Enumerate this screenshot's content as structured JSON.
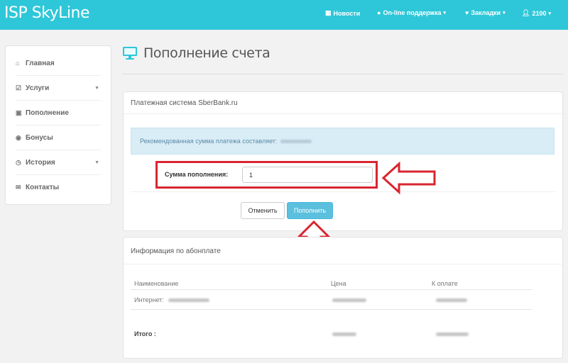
{
  "app": {
    "brand": "ISP SkyLine"
  },
  "topnav": {
    "items": [
      {
        "icon": "calendar-icon",
        "label": "Новости"
      },
      {
        "icon": "chat-icon",
        "label": "On-line поддержка"
      },
      {
        "icon": "heart-icon",
        "label": "Закладки"
      },
      {
        "icon": "user-icon",
        "label": "2100"
      }
    ]
  },
  "sidebar": {
    "items": [
      {
        "icon": "home-icon",
        "label": "Главная"
      },
      {
        "icon": "checkbox-icon",
        "label": "Услуги"
      },
      {
        "icon": "money-icon",
        "label": "Пополнение"
      },
      {
        "icon": "gift-icon",
        "label": "Бонусы"
      },
      {
        "icon": "clock-icon",
        "label": "История"
      },
      {
        "icon": "envelope-icon",
        "label": "Контакты"
      }
    ]
  },
  "page": {
    "title": "Пополнение счета"
  },
  "payment": {
    "header": "Платежная система SberBank.ru",
    "recommended_text": "Рекомендованная сумма платежа составляет:",
    "amount_label": "Сумма пополнения:",
    "amount_value": "1",
    "cancel_label": "Отменить",
    "submit_label": "Пополнить"
  },
  "fee_info": {
    "header": "Информация по абонплате",
    "columns": [
      "Наименование",
      "Цена",
      "К оплате"
    ],
    "row_label": "Интернет:",
    "total_label": "Итого :"
  },
  "colors": {
    "topbar": "#2ec7d9",
    "accent": "#5bc0de",
    "highlight": "#d9252f"
  }
}
